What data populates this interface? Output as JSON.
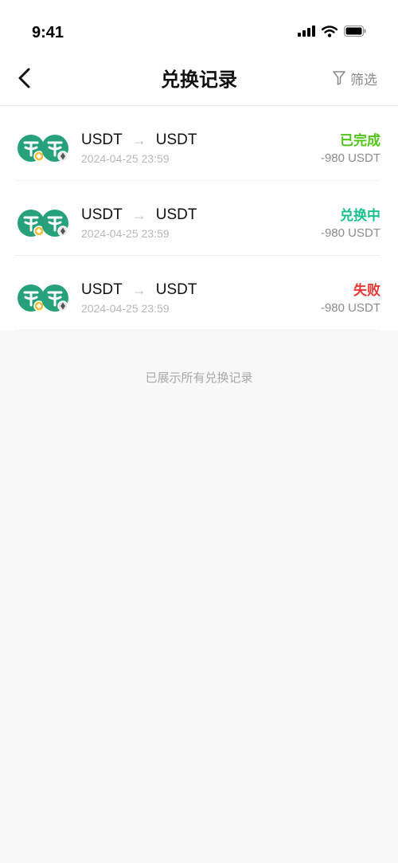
{
  "status_bar": {
    "time": "9:41"
  },
  "header": {
    "title": "兑换记录",
    "filter_label": "筛选"
  },
  "records": [
    {
      "from": "USDT",
      "to": "USDT",
      "date": "2024-04-25 23:59",
      "status": "已完成",
      "status_color": "#52c41a",
      "amount": "-980 USDT"
    },
    {
      "from": "USDT",
      "to": "USDT",
      "date": "2024-04-25 23:59",
      "status": "兑换中",
      "status_color": "#1bc08e",
      "amount": "-980 USDT"
    },
    {
      "from": "USDT",
      "to": "USDT",
      "date": "2024-04-25 23:59",
      "status": "失败",
      "status_color": "#e53935",
      "amount": "-980 USDT"
    }
  ],
  "footer": {
    "note": "已展示所有兑换记录"
  },
  "colors": {
    "tether_green": "#26a17b",
    "bnb_yellow": "#f3ba2f"
  }
}
